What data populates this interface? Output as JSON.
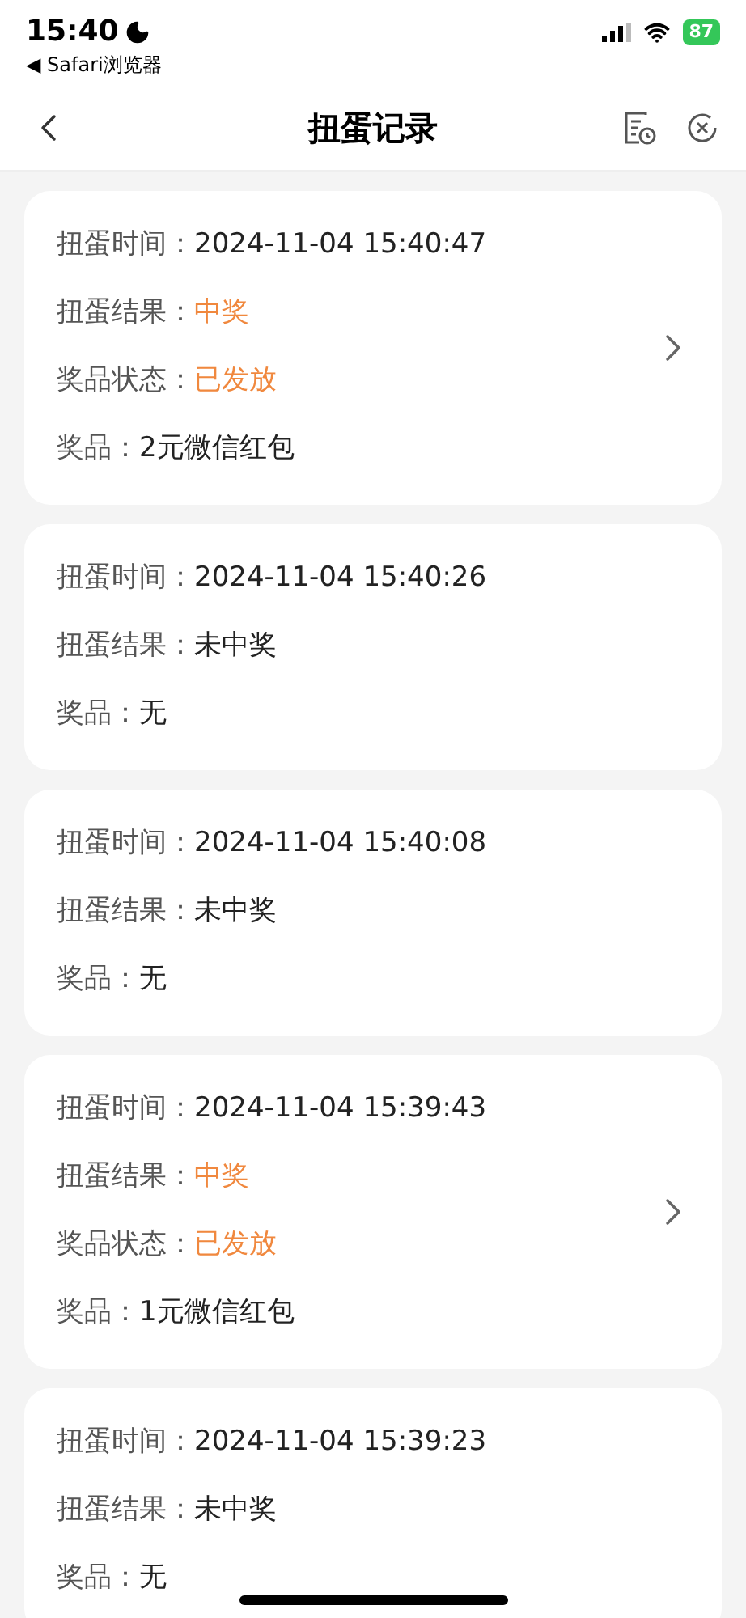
{
  "status_bar": {
    "time": "15:40",
    "back_app": "◀ Safari浏览器",
    "battery": "87"
  },
  "nav": {
    "title": "扭蛋记录"
  },
  "records": [
    {
      "has_arrow": true,
      "rows": [
        {
          "label": "扭蛋时间：",
          "value": "2024-11-04 15:40:47",
          "emphasized": false
        },
        {
          "label": "扭蛋结果：",
          "value": "中奖",
          "emphasized": true
        },
        {
          "label": "奖品状态：",
          "value": "已发放",
          "emphasized": true
        },
        {
          "label": "奖品：",
          "value": "2元微信红包",
          "emphasized": false
        }
      ]
    },
    {
      "has_arrow": false,
      "rows": [
        {
          "label": "扭蛋时间：",
          "value": "2024-11-04 15:40:26",
          "emphasized": false
        },
        {
          "label": "扭蛋结果：",
          "value": "未中奖",
          "emphasized": false
        },
        {
          "label": "奖品：",
          "value": "无",
          "emphasized": false
        }
      ]
    },
    {
      "has_arrow": false,
      "rows": [
        {
          "label": "扭蛋时间：",
          "value": "2024-11-04 15:40:08",
          "emphasized": false
        },
        {
          "label": "扭蛋结果：",
          "value": "未中奖",
          "emphasized": false
        },
        {
          "label": "奖品：",
          "value": "无",
          "emphasized": false
        }
      ]
    },
    {
      "has_arrow": true,
      "rows": [
        {
          "label": "扭蛋时间：",
          "value": "2024-11-04 15:39:43",
          "emphasized": false
        },
        {
          "label": "扭蛋结果：",
          "value": "中奖",
          "emphasized": true
        },
        {
          "label": "奖品状态：",
          "value": "已发放",
          "emphasized": true
        },
        {
          "label": "奖品：",
          "value": "1元微信红包",
          "emphasized": false
        }
      ]
    },
    {
      "has_arrow": false,
      "rows": [
        {
          "label": "扭蛋时间：",
          "value": "2024-11-04 15:39:23",
          "emphasized": false
        },
        {
          "label": "扭蛋结果：",
          "value": "未中奖",
          "emphasized": false
        },
        {
          "label": "奖品：",
          "value": "无",
          "emphasized": false
        }
      ]
    }
  ]
}
